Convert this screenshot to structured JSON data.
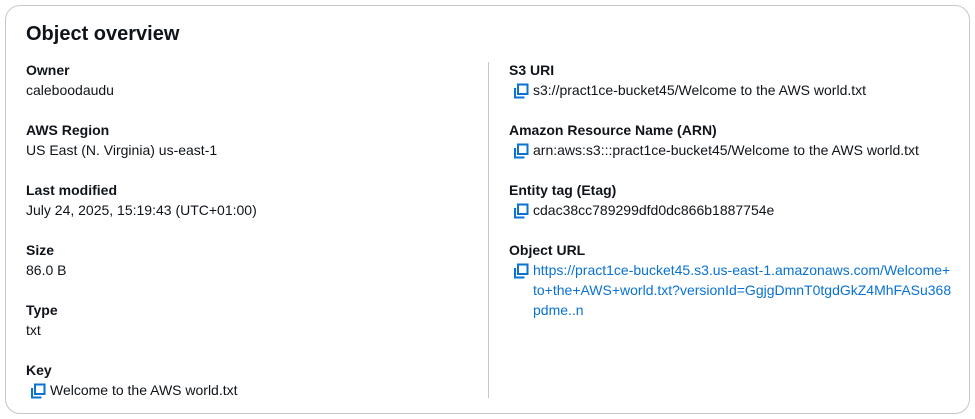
{
  "panel": {
    "title": "Object overview"
  },
  "left": {
    "owner": {
      "label": "Owner",
      "value": "caleboodaudu"
    },
    "region": {
      "label": "AWS Region",
      "value": "US East (N. Virginia) us-east-1"
    },
    "modified": {
      "label": "Last modified",
      "value": "July 24, 2025, 15:19:43 (UTC+01:00)"
    },
    "size": {
      "label": "Size",
      "value": "86.0 B"
    },
    "type": {
      "label": "Type",
      "value": "txt"
    },
    "key": {
      "label": "Key",
      "value": "Welcome to the AWS world.txt"
    }
  },
  "right": {
    "s3uri": {
      "label": "S3 URI",
      "value": "s3://pract1ce-bucket45/Welcome to the AWS world.txt"
    },
    "arn": {
      "label": "Amazon Resource Name (ARN)",
      "value": "arn:aws:s3:::pract1ce-bucket45/Welcome to the AWS world.txt"
    },
    "etag": {
      "label": "Entity tag (Etag)",
      "value": "cdac38cc789299dfd0dc866b1887754e"
    },
    "url": {
      "label": "Object URL",
      "value": "https://pract1ce-bucket45.s3.us-east-1.amazonaws.com/Welcome+to+the+AWS+world.txt?versionId=GgjgDmnT0tgdGkZ4MhFASu368pdme..n"
    }
  },
  "colors": {
    "text": "#0f141a",
    "link": "#0972d3",
    "border": "#c6c6cd"
  },
  "icons": {
    "copy": "copy-icon"
  }
}
